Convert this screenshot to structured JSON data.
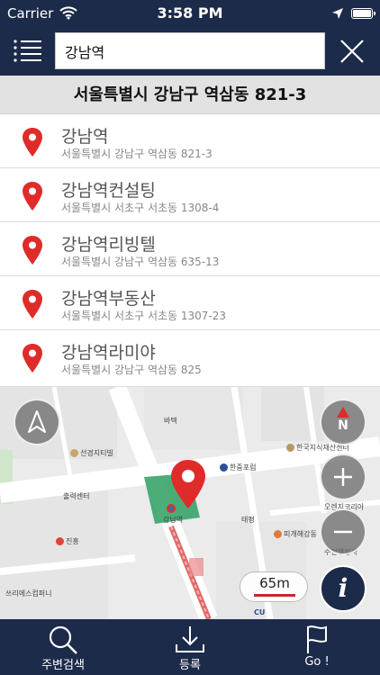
{
  "status_bar": {
    "carrier": "Carrier",
    "time": "3:58 PM",
    "icons": [
      "wifi-icon",
      "location-arrow-icon",
      "battery-icon"
    ]
  },
  "nav": {
    "menu_icon": "menu-icon",
    "search_value": "강남역",
    "close_icon": "close-icon"
  },
  "address_banner": "서울특별시 강남구 역삼동 821-3",
  "results": [
    {
      "name": "강남역",
      "address": "서울특별시 강남구 역삼동 821-3"
    },
    {
      "name": "강남역컨설팅",
      "address": "서울특별시 서초구 서초동 1308-4"
    },
    {
      "name": "강남역리빙텔",
      "address": "서울특별시 강남구 역삼동 635-13"
    },
    {
      "name": "강남역부동산",
      "address": "서울특별시 서초구 서초동 1307-23"
    },
    {
      "name": "강남역라미야",
      "address": "서울특별시 강남구 역삼동 825"
    }
  ],
  "map": {
    "pois": {
      "p1": "바텍",
      "p2": "선경지티빌",
      "p3": "한국지식재산센터",
      "p4": "한중포럼",
      "p5": "출력센터",
      "p6": "강남역",
      "p7": "태평",
      "p8": "오렌지코리아",
      "p9": "진흥",
      "p10": "피개해강동",
      "p11": "수정행정사",
      "p12": "쓰리에스컴퍼니",
      "p13": "CU"
    },
    "compass_label": "N",
    "scale_label": "65m",
    "info_label": "i"
  },
  "tabbar": {
    "nearby": "주변검색",
    "register": "등록",
    "go": "Go !"
  },
  "colors": {
    "navy": "#1d2b4a",
    "pin_red": "#e02b2b",
    "banner_gray": "#e2e2e2"
  }
}
